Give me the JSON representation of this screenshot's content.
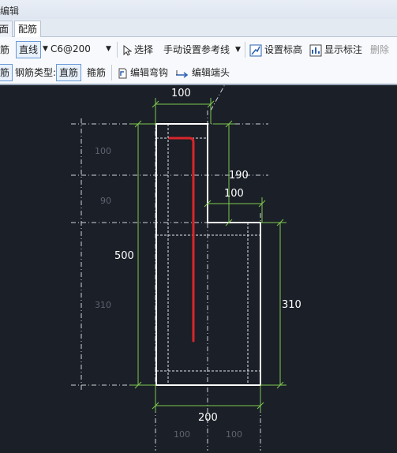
{
  "window": {
    "title": "编辑"
  },
  "tabs": [
    {
      "label": "面"
    },
    {
      "label": "配筋"
    }
  ],
  "toolbar1": {
    "rebar_left": "筋",
    "line_mode": "直线",
    "spec_value": "C6@200",
    "select": "选择",
    "manual_ref": "手动设置参考线",
    "set_elevation": "设置标高",
    "show_labels": "显示标注",
    "delete": "删除"
  },
  "toolbar2": {
    "rebar_left": "筋",
    "rebar_type_label": "钢筋类型:",
    "straight": "直筋",
    "stirrup": "箍筋",
    "edit_hook": "编辑弯钩",
    "edit_end": "编辑端头"
  },
  "drawing": {
    "dim_top": "100",
    "dim_right_upper": "190",
    "dim_step": "100",
    "dim_left": "500",
    "dim_right_lower": "310",
    "dim_bottom": "200",
    "faint_left_1": "100",
    "faint_left_2": "90",
    "faint_left_3": "310",
    "faint_bottom_1": "100",
    "faint_bottom_2": "100"
  },
  "colors": {
    "rebar": "#d9262b",
    "dimension": "#7ec850",
    "outline": "#ffffff",
    "background": "#1b1f27"
  }
}
